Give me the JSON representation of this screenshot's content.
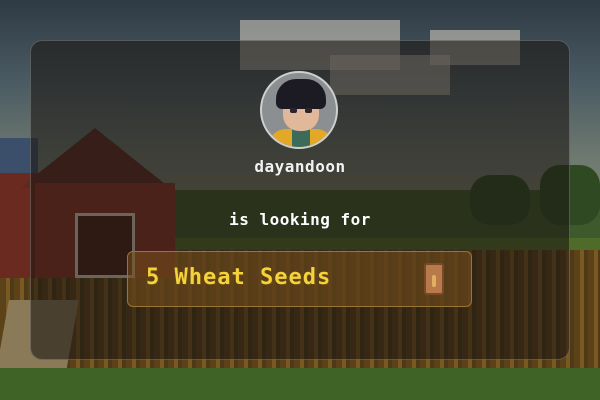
{
  "request": {
    "username": "dayandoon",
    "message": "is looking for",
    "item_text": "5 Wheat Seeds",
    "item_icon": "wheat-seed-packet-icon"
  },
  "colors": {
    "item_text": "#f4d23b",
    "panel_bg": "rgba(28,22,18,0.58)",
    "item_box_border": "#9c7436"
  }
}
